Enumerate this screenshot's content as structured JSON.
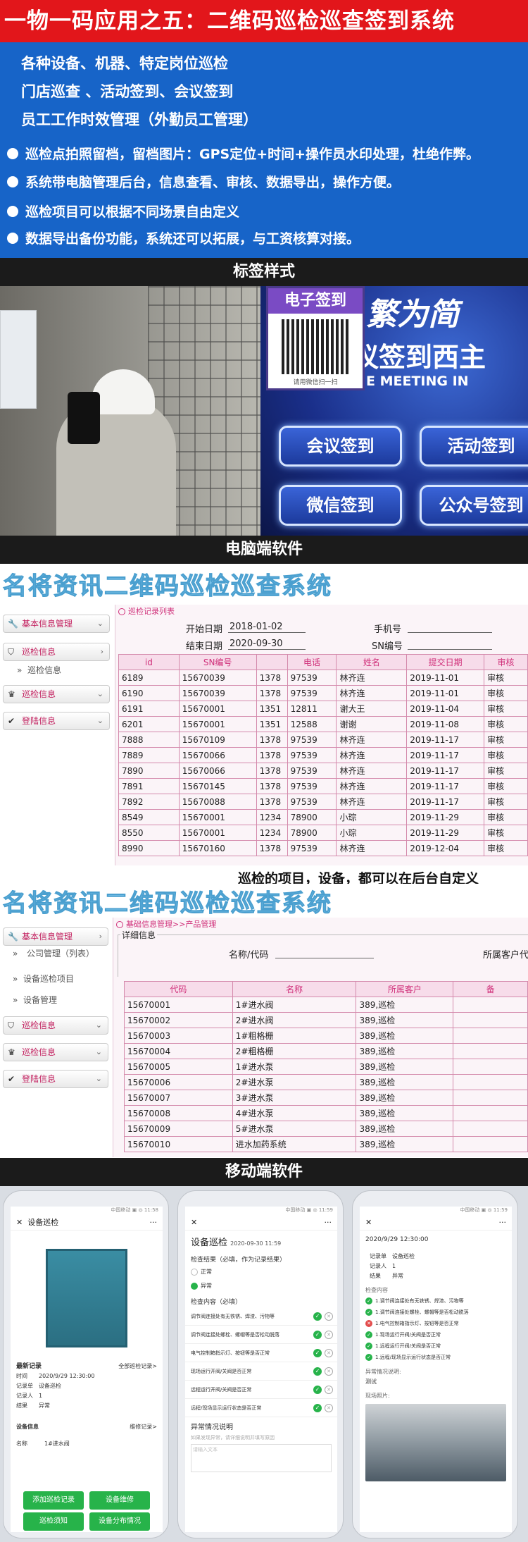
{
  "title": "一物一码应用之五：二维码巡检巡查签到系统",
  "intro": {
    "lines": [
      "各种设备、机器、特定岗位巡检",
      "门店巡查 、活动签到、会议签到",
      "员工工作时效管理（外勤员工管理）"
    ],
    "bullets": [
      "巡检点拍照留档，留档图片：GPS定位+时间+操作员水印处理，杜绝作弊。",
      "系统带电脑管理后台，信息查看、审核、数据导出，操作方便。",
      "巡检项目可以根据不同场景自由定义",
      "数据导出备份功能，系统还可以拓展，与工资核算对接。"
    ]
  },
  "sections": {
    "tag_style": "标签样式",
    "pc_software": "电脑端软件",
    "mobile_software": "移动端软件"
  },
  "photo": {
    "qr_title": "电子签到",
    "qr_sub": "请用微信扫一扫",
    "bg_text_1": "繁为简",
    "bg_text_2": "议签到西主",
    "bg_text_3": "E MEETING IN",
    "buttons": [
      "会议签到",
      "活动签到",
      "微信签到",
      "公众号签到"
    ]
  },
  "pc1": {
    "brand": "名将资讯二维码巡检巡查系统",
    "sidebar": [
      {
        "label": "基本信息管理",
        "icon": "wrench-icon",
        "expanded": false
      },
      {
        "label": "巡检信息",
        "icon": "shield-icon",
        "expanded": true,
        "sub": [
          "巡检信息"
        ]
      },
      {
        "label": "巡检信息",
        "icon": "crown-icon",
        "expanded": false
      },
      {
        "label": "登陆信息",
        "icon": "check-icon",
        "expanded": false
      }
    ],
    "breadcrumb": "巡检记录列表",
    "filters": {
      "start_label": "开始日期",
      "start_value": "2018-01-02",
      "end_label": "结束日期",
      "end_value": "2020-09-30",
      "phone_label": "手机号",
      "sn_label": "SN编号"
    },
    "columns": [
      "id",
      "SN编号",
      "",
      "电话",
      "姓名",
      "提交日期",
      "审核"
    ],
    "rows": [
      [
        "6189",
        "15670039",
        "1378",
        "97539",
        "林齐连",
        "2019-11-01",
        "审核"
      ],
      [
        "6190",
        "15670039",
        "1378",
        "97539",
        "林齐连",
        "2019-11-01",
        "审核"
      ],
      [
        "6191",
        "15670001",
        "1351",
        "12811",
        "谢大王",
        "2019-11-04",
        "审核"
      ],
      [
        "6201",
        "15670001",
        "1351",
        "12588",
        "谢谢",
        "2019-11-08",
        "审核"
      ],
      [
        "7888",
        "15670109",
        "1378",
        "97539",
        "林齐连",
        "2019-11-17",
        "审核"
      ],
      [
        "7889",
        "15670066",
        "1378",
        "97539",
        "林齐连",
        "2019-11-17",
        "审核"
      ],
      [
        "7890",
        "15670066",
        "1378",
        "97539",
        "林齐连",
        "2019-11-17",
        "审核"
      ],
      [
        "7891",
        "15670145",
        "1378",
        "97539",
        "林齐连",
        "2019-11-17",
        "审核"
      ],
      [
        "7892",
        "15670088",
        "1378",
        "97539",
        "林齐连",
        "2019-11-17",
        "审核"
      ],
      [
        "8549",
        "15670001",
        "1234",
        "78900",
        "小琮",
        "2019-11-29",
        "审核"
      ],
      [
        "8550",
        "15670001",
        "1234",
        "78900",
        "小琮",
        "2019-11-29",
        "审核"
      ],
      [
        "8990",
        "15670160",
        "1378",
        "97539",
        "林齐连",
        "2019-12-04",
        "审核"
      ]
    ],
    "caption": "巡检的项目，设备，都可以在后台自定义"
  },
  "pc2": {
    "brand": "名将资讯二维码巡检巡查系统",
    "sidebar_top": "基本信息管理",
    "subs": [
      "公司管理（列表）",
      "设备巡检项目",
      "设备管理"
    ],
    "sidebar_rest": [
      {
        "label": "巡检信息",
        "icon": "shield-icon"
      },
      {
        "label": "巡检信息",
        "icon": "crown-icon"
      },
      {
        "label": "登陆信息",
        "icon": "check-icon"
      }
    ],
    "breadcrumb": "基础信息管理>>产品管理",
    "legend": "详细信息",
    "name_label": "名称/代码",
    "owner_label": "所属客户代",
    "columns": [
      "代码",
      "名称",
      "所属客户",
      "备"
    ],
    "rows": [
      [
        "15670001",
        "1#进水阀",
        "389,巡检",
        ""
      ],
      [
        "15670002",
        "2#进水阀",
        "389,巡检",
        ""
      ],
      [
        "15670003",
        "1#粗格栅",
        "389,巡检",
        ""
      ],
      [
        "15670004",
        "2#粗格栅",
        "389,巡检",
        ""
      ],
      [
        "15670005",
        "1#进水泵",
        "389,巡检",
        ""
      ],
      [
        "15670006",
        "2#进水泵",
        "389,巡检",
        ""
      ],
      [
        "15670007",
        "3#进水泵",
        "389,巡检",
        ""
      ],
      [
        "15670008",
        "4#进水泵",
        "389,巡检",
        ""
      ],
      [
        "15670009",
        "5#进水泵",
        "389,巡检",
        ""
      ],
      [
        "15670010",
        "进水加药系统",
        "389,巡检",
        ""
      ]
    ]
  },
  "m1": {
    "status": "中国移动 ▣ ◎ 11:58",
    "nav": "设备巡检",
    "latest": "最新记录",
    "all": "全部巡检记录>",
    "rows": [
      "时间　　2020/9/29 12:30:00",
      "记录单　设备巡检",
      "记录人　1",
      "结果　　异常"
    ],
    "device_info": "设备信息",
    "maint": "维修记录>",
    "name_row": "名称　　　1#进水阀",
    "b1": "添加巡检记录",
    "b2": "设备维修",
    "b3": "巡检须知",
    "b4": "设备分布情况"
  },
  "m2": {
    "status": "中国移动 ▣ ◎ 11:59",
    "title": "设备巡检",
    "title_date": "2020-09-30 11:59",
    "result_label": "检查结果（必填，作为记录结果）",
    "ok": "正常",
    "bad": "异常",
    "content_label": "检查内容（必填）",
    "items": [
      "调节阀连接处有无铁锈、焊渣、污物等",
      "调节阀连接处螺栓、螺帽等是否松动脱落",
      "电气控制箱指示灯、按钮等是否正常",
      "现场运行开阀/关阀是否正常",
      "远程运行开阀/关阀是否正常",
      "远程/现场显示运行状态是否正常"
    ],
    "abn_label": "异常情况说明",
    "abn_hint": "如果发现异常，请详细说明并填写原因",
    "abn_placeholder": "请输入文本"
  },
  "m3": {
    "status": "中国移动 ▣ ◎ 11:59",
    "date": "2020/9/29 12:30:00",
    "rows": [
      "记录单　设备巡检",
      "记录人　1",
      "结果　　异常"
    ],
    "content_label": "检查内容",
    "items": [
      "1.调节阀连接处有无铁锈、焊渣、污物等",
      "1.调节阀连接处螺栓、螺帽等是否松动脱落",
      "1.电气控制箱指示灯、按钮等是否正常",
      "1.现场运行开阀/关阀是否正常",
      "1.远程运行开阀/关阀是否正常",
      "1.远程/现场显示运行状态是否正常"
    ],
    "abn_label": "异常情况说明:",
    "abn_value": "测试",
    "photo_label": "现场照片:"
  }
}
